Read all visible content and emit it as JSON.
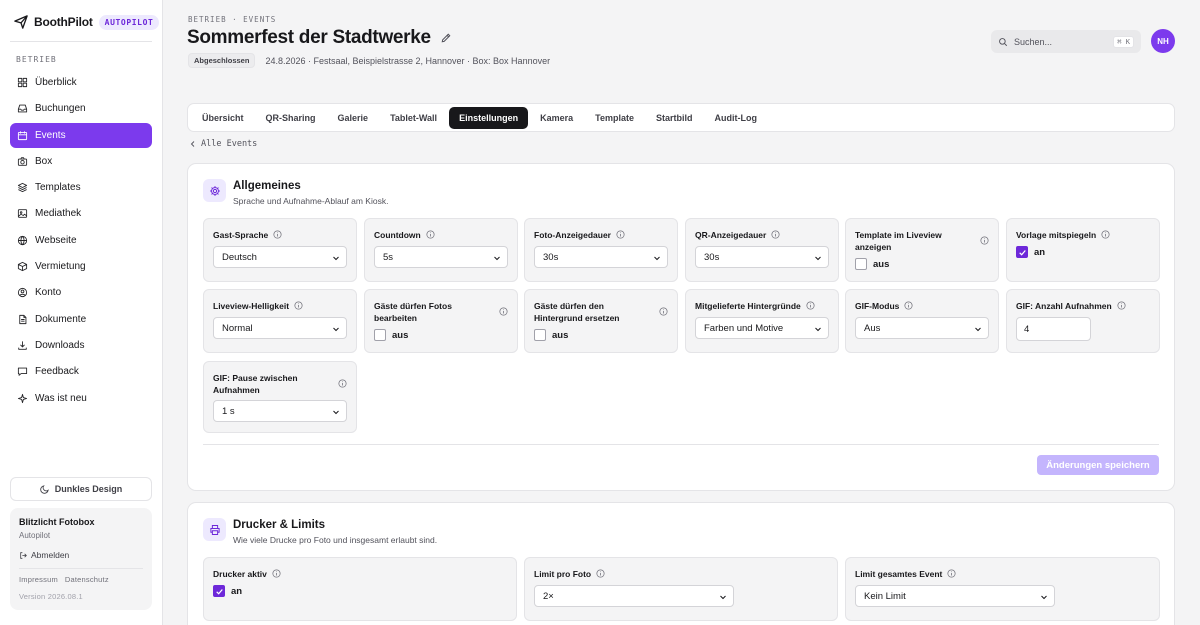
{
  "brand": {
    "name": "BoothPilot",
    "badge": "AUTOPILOT"
  },
  "sidebar": {
    "section": "BETRIEB",
    "items": [
      {
        "label": "Überblick",
        "icon": "grid-icon"
      },
      {
        "label": "Buchungen",
        "icon": "inbox-icon"
      },
      {
        "label": "Events",
        "icon": "calendar-icon",
        "active": true
      },
      {
        "label": "Box",
        "icon": "camera-icon"
      },
      {
        "label": "Templates",
        "icon": "layers-icon"
      },
      {
        "label": "Mediathek",
        "icon": "image-icon"
      },
      {
        "label": "Webseite",
        "icon": "globe-icon"
      },
      {
        "label": "Vermietung",
        "icon": "package-icon"
      },
      {
        "label": "Konto",
        "icon": "user-icon"
      },
      {
        "label": "Dokumente",
        "icon": "file-icon"
      },
      {
        "label": "Downloads",
        "icon": "download-icon"
      },
      {
        "label": "Feedback",
        "icon": "chat-icon"
      },
      {
        "label": "Was ist neu",
        "icon": "sparkle-icon"
      }
    ],
    "dark_mode": "Dunkles Design",
    "account": {
      "name": "Blitzlicht Fotobox",
      "plan": "Autopilot",
      "logout": "Abmelden",
      "imprint": "Impressum",
      "privacy": "Datenschutz",
      "version": "Version 2026.08.1"
    }
  },
  "header": {
    "breadcrumb": "BETRIEB · EVENTS",
    "title": "Sommerfest der Stadtwerke",
    "status": "Abgeschlossen",
    "meta": "24.8.2026 · Festsaal, Beispielstrasse 2, Hannover · Box: Box Hannover",
    "search_placeholder": "Suchen...",
    "search_shortcut": "⌘ K",
    "avatar": "NH"
  },
  "tabs": [
    "Übersicht",
    "QR-Sharing",
    "Galerie",
    "Tablet-Wall",
    "Einstellungen",
    "Kamera",
    "Template",
    "Startbild",
    "Audit-Log"
  ],
  "active_tab": "Einstellungen",
  "back_link": "Alle Events",
  "general": {
    "title": "Allgemeines",
    "subtitle": "Sprache und Aufnahme-Ablauf am Kiosk.",
    "fields": {
      "language": {
        "label": "Gast-Sprache",
        "value": "Deutsch"
      },
      "countdown": {
        "label": "Countdown",
        "value": "5s"
      },
      "photo_duration": {
        "label": "Foto-Anzeigedauer",
        "value": "30s"
      },
      "qr_duration": {
        "label": "QR-Anzeigedauer",
        "value": "30s"
      },
      "template_liveview": {
        "label": "Template im Liveview anzeigen",
        "checked": false,
        "state": "aus"
      },
      "mirror": {
        "label": "Vorlage mitspiegeln",
        "checked": true,
        "state": "an"
      },
      "brightness": {
        "label": "Liveview-Helligkeit",
        "value": "Normal"
      },
      "guest_edit": {
        "label": "Gäste dürfen Fotos bearbeiten",
        "checked": false,
        "state": "aus"
      },
      "guest_bg": {
        "label": "Gäste dürfen den Hintergrund ersetzen",
        "checked": false,
        "state": "aus"
      },
      "backgrounds": {
        "label": "Mitgelieferte Hintergründe",
        "value": "Farben und Motive"
      },
      "gif_mode": {
        "label": "GIF-Modus",
        "value": "Aus"
      },
      "gif_count": {
        "label": "GIF: Anzahl Aufnahmen",
        "value": "4"
      },
      "gif_pause": {
        "label": "GIF: Pause zwischen Aufnahmen",
        "value": "1 s"
      }
    },
    "save": "Änderungen speichern"
  },
  "printer": {
    "title": "Drucker & Limits",
    "subtitle": "Wie viele Drucke pro Foto und insgesamt erlaubt sind.",
    "fields": {
      "active": {
        "label": "Drucker aktiv",
        "checked": true,
        "state": "an"
      },
      "per_photo": {
        "label": "Limit pro Foto",
        "value": "2×"
      },
      "total": {
        "label": "Limit gesamtes Event",
        "value": "Kein Limit"
      }
    }
  },
  "colors": {
    "accent": "#7c3aed",
    "accent_light": "#ede9fe",
    "save_disabled": "#c4b5fd"
  }
}
